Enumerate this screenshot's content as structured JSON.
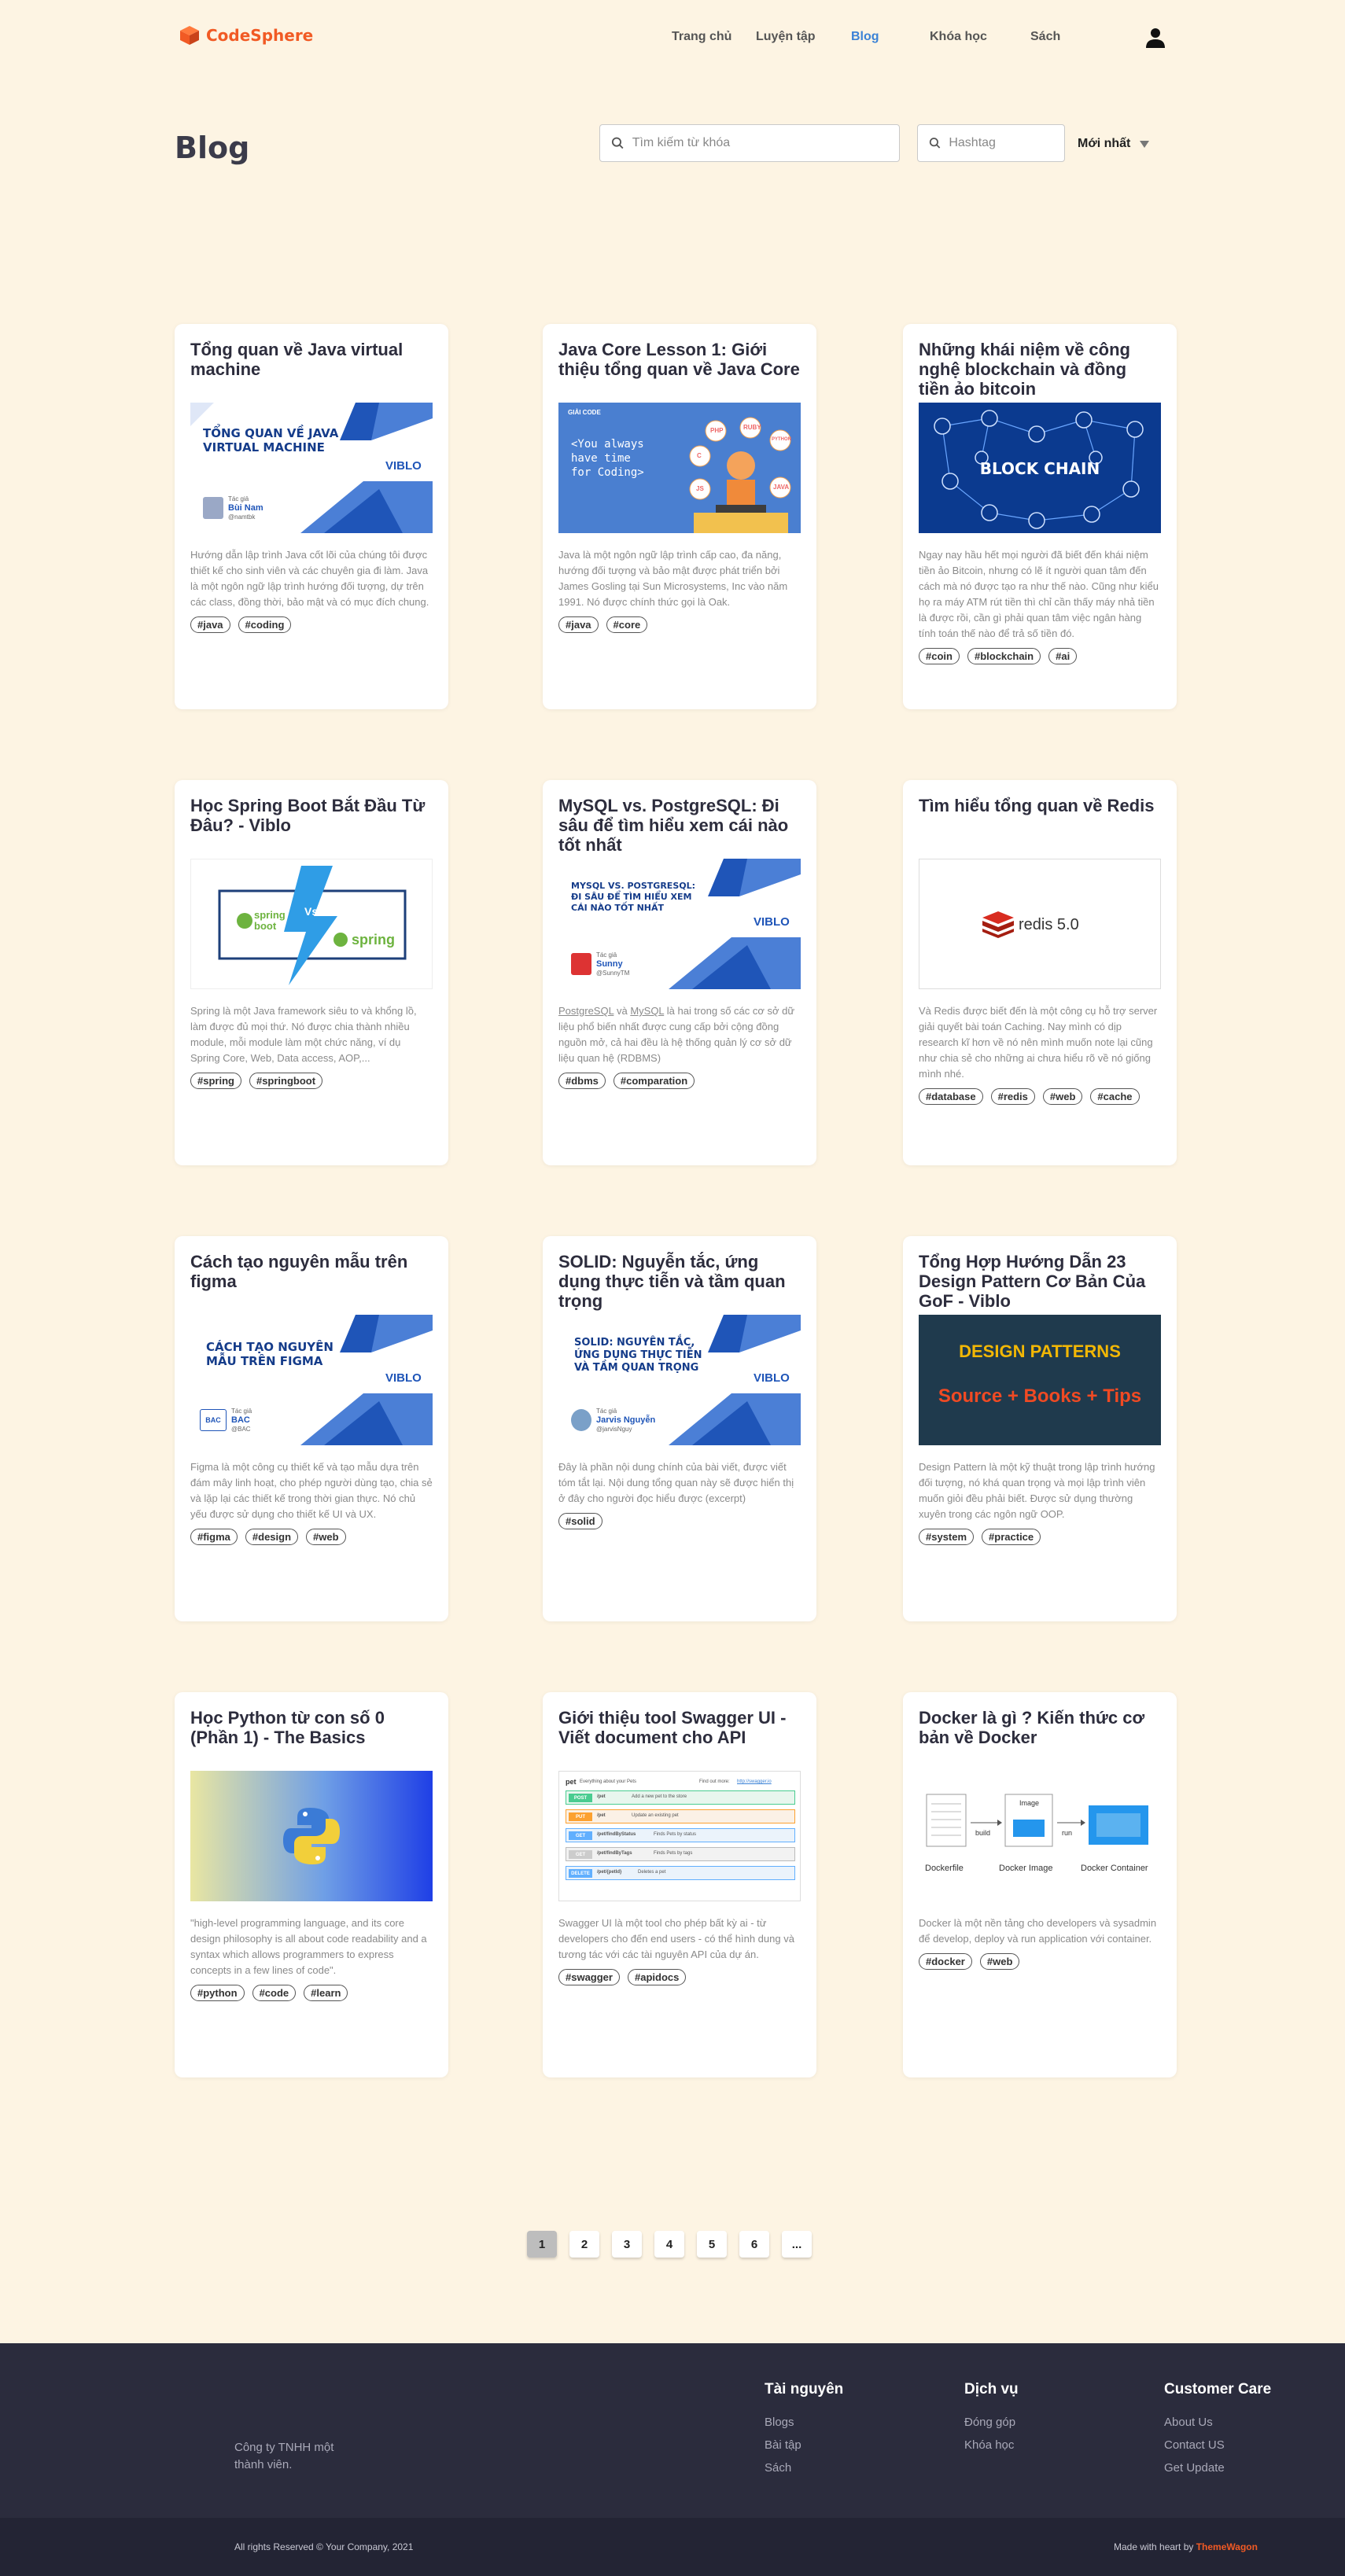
{
  "brand": {
    "name": "CodeSphere",
    "accent": "#f15a24"
  },
  "nav": {
    "links": [
      {
        "label": "Trang chủ"
      },
      {
        "label": "Luyện tập"
      },
      {
        "label": "Blog",
        "active": true
      },
      {
        "label": "Khóa học"
      },
      {
        "label": "Sách"
      }
    ],
    "user_icon": "user-icon"
  },
  "page": {
    "title": "Blog"
  },
  "filters": {
    "search_placeholder": "Tìm kiếm từ khóa",
    "hashtag_placeholder": "Hashtag",
    "sort_value": "Mới nhất"
  },
  "posts": [
    {
      "title": "Tổng quan về Java virtual machine",
      "thumb_text": [
        "TỔNG QUAN VỀ JAVA",
        "VIRTUAL MACHINE"
      ],
      "thumb_brand": "VIBLO",
      "thumb_author_label": "Tác giả",
      "thumb_author": "Bùi Nam",
      "thumb_handle": "@namtbk",
      "excerpt": "Hướng dẫn lập trình Java cốt lõi của chúng tôi được thiết kế cho sinh viên và các chuyên gia đi làm. Java là một ngôn ngữ lập trình hướng đối tượng, dự trên các class, đồng thời, bảo mật và có mục đích chung.",
      "tags": [
        "#java",
        "#coding"
      ]
    },
    {
      "title": "Java Core Lesson 1: Giới thiệu tổng quan về Java Core",
      "thumb_text": [
        "<You always",
        "have time",
        "for Coding>"
      ],
      "thumb_brand": "GIẢI CODE",
      "thumb_bubbles": [
        "C",
        "PHP",
        "RUBY",
        "JS",
        "JAVA",
        "PYTHON"
      ],
      "excerpt": "Java là một ngôn ngữ lập trình cấp cao, đa năng, hướng đối tượng và bảo mật được phát triển bởi James Gosling tại Sun Microsystems, Inc vào năm 1991. Nó được chính thức gọi là Oak.",
      "tags": [
        "#java",
        "#core"
      ]
    },
    {
      "title": "Những khái niệm về công nghệ blockchain và đồng tiền ảo bitcoin",
      "thumb_text": [
        "BLOCK CHAIN"
      ],
      "excerpt": "Ngay nay hầu hết mọi người đã biết đến khái niệm tiền ảo Bitcoin, nhưng có lẽ ít người quan tâm đến cách mà nó được tạo ra như thế nào. Cũng như kiểu họ ra máy ATM rút tiền thì chỉ cần thấy máy nhả tiền là được rồi, cần gì phải quan tâm việc ngân hàng tính toán thế nào để trả số tiền đó.",
      "tags": [
        "#coin",
        "#blockchain",
        "#ai"
      ]
    },
    {
      "title": "Học Spring Boot Bắt Đầu Từ Đâu? - Viblo",
      "thumb_text": [
        "spring",
        "boot",
        "Vs",
        "spring"
      ],
      "excerpt": "Spring là một Java framework siêu to và khổng lồ, làm được đủ mọi thứ. Nó được chia thành nhiều module, mỗi module làm một chức năng, ví dụ Spring Core, Web, Data access, AOP,...",
      "tags": [
        "#spring",
        "#springboot"
      ]
    },
    {
      "title": "MySQL vs. PostgreSQL: Đi sâu để tìm hiểu xem cái nào tốt nhất",
      "thumb_text": [
        "MYSQL VS. POSTGRESQL:",
        "ĐI SÂU ĐỂ TÌM HIỂU XEM",
        "CÁI NÀO TỐT NHẤT"
      ],
      "thumb_brand": "VIBLO",
      "thumb_author_label": "Tác giả",
      "thumb_author": "Sunny",
      "thumb_handle": "@SunnyTM",
      "excerpt_links": [
        "PostgreSQL",
        "MySQL"
      ],
      "excerpt_parts": [
        "",
        " và ",
        " là hai trong số các cơ sở dữ liệu phổ biến nhất được cung cấp bởi cộng đồng nguồn mở, cả hai đều là hệ thống quản lý cơ sở dữ liệu quan hệ (RDBMS)"
      ],
      "tags": [
        "#dbms",
        "#comparation"
      ]
    },
    {
      "title": "Tìm hiểu tổng quan về Redis",
      "thumb_text": [
        "redis 5.0"
      ],
      "excerpt": "Và Redis được biết đến là một công cụ hỗ trợ server giải quyết bài toán Caching. Nay mình có dịp research kĩ hơn về nó nên mình muốn note lại cũng như chia sẻ cho những ai chưa hiểu rõ về nó giống mình nhé.",
      "tags": [
        "#database",
        "#redis",
        "#web",
        "#cache"
      ]
    },
    {
      "title": "Cách tạo nguyên mẫu trên figma",
      "thumb_text": [
        "CÁCH TẠO NGUYÊN",
        "MẪU TRÊN FIGMA"
      ],
      "thumb_brand": "VIBLO",
      "thumb_author_label": "Tác giả",
      "thumb_author": "BAC",
      "thumb_handle": "@BAC",
      "thumb_org": "BAC",
      "excerpt": "Figma là một công cụ thiết kế và tạo mẫu dựa trên đám mây linh hoạt, cho phép người dùng tạo, chia sẻ và lặp lại các thiết kế trong thời gian thực. Nó chủ yếu được sử dụng cho thiết kế UI và UX.",
      "tags": [
        "#figma",
        "#design",
        "#web"
      ]
    },
    {
      "title": "SOLID: Nguyễn tắc, ứng dụng thực tiễn và tầm quan trọng",
      "thumb_text": [
        "SOLID: NGUYÊN TẮC,",
        "ỨNG DỤNG THỰC TIỄN",
        "VÀ TẦM QUAN TRỌNG"
      ],
      "thumb_brand": "VIBLO",
      "thumb_author_label": "Tác giả",
      "thumb_author": "Jarvis Nguyễn",
      "thumb_handle": "@jarvisNguy",
      "excerpt": "Đây là phần nội dung chính của bài viết, được viết tóm tắt lại. Nội dung tổng quan này sẽ được hiển thị ở đây cho người đọc hiểu được (excerpt)",
      "tags": [
        "#solid"
      ]
    },
    {
      "title": "Tổng Hợp Hướng Dẫn 23 Design Pattern Cơ Bản Của GoF - Viblo",
      "thumb_text": [
        "DESIGN PATTERNS",
        "Source + Books + Tips"
      ],
      "excerpt": "Design Pattern là một kỹ thuật trong lập trình hướng đối tượng, nó khá quan trọng và mọi lập trình viên muốn giỏi đều phải biết. Được sử dụng thường xuyên trong các ngôn ngữ OOP.",
      "tags": [
        "#system",
        "#practice"
      ]
    },
    {
      "title": "Học Python từ con số 0 (Phần 1) - The Basics",
      "thumb_text": [],
      "excerpt": "\"high-level programming language, and its core design philosophy is all about code readability and a syntax which allows programmers to express concepts in a few lines of code\".",
      "tags": [
        "#python",
        "#code",
        "#learn"
      ]
    },
    {
      "title": "Giới thiệu tool Swagger UI - Viết document cho API",
      "thumb_text": [
        "pet",
        "Everything about your Pets",
        "Find out more:",
        "http://swagger.io",
        "POST",
        "PUT",
        "GET",
        "GET",
        "DELETE",
        "/pet",
        "/pet",
        "/pet/findByStatus",
        "/pet/findByTags",
        "/pet/{petId}",
        "Add a new pet to the store",
        "Update an existing pet",
        "Finds Pets by status",
        "Finds Pets by tags",
        "Deletes a pet"
      ],
      "excerpt": "Swagger UI là một tool cho phép bất kỳ ai - từ developers cho đến end users - có thể hình dung và tương tác với các tài nguyên API của dự án.",
      "tags": [
        "#swagger",
        "#apidocs"
      ]
    },
    {
      "title": "Docker là gì ? Kiến thức cơ bản về Docker",
      "thumb_text": [
        "Dockerfile",
        "Docker Image",
        "Docker Container",
        "build",
        "run",
        "Image"
      ],
      "excerpt": "Docker là một nền tảng cho developers và sysadmin để develop, deploy và run application với container.",
      "tags": [
        "#docker",
        "#web"
      ]
    }
  ],
  "pagination": {
    "pages": [
      "1",
      "2",
      "3",
      "4",
      "5",
      "6",
      "..."
    ],
    "current": "1"
  },
  "footer": {
    "company": "Công ty TNHH một thành viên.",
    "columns": [
      {
        "title": "Tài nguyên",
        "links": [
          "Blogs",
          "Bài tập",
          "Sách"
        ]
      },
      {
        "title": "Dịch vụ",
        "links": [
          "Đóng góp",
          "Khóa học"
        ]
      },
      {
        "title": "Customer Care",
        "links": [
          "About Us",
          "Contact US",
          "Get Update"
        ]
      }
    ],
    "copyright": "All rights Reserved © Your Company, 2021",
    "made_prefix": "Made with heart by ",
    "made_brand": "ThemeWagon"
  }
}
